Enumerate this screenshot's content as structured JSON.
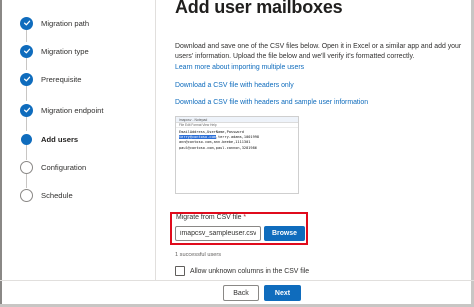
{
  "wizard": {
    "steps": [
      {
        "label": "Migration path",
        "state": "done"
      },
      {
        "label": "Migration type",
        "state": "done"
      },
      {
        "label": "Prerequisite",
        "state": "done"
      },
      {
        "label": "Migration endpoint",
        "state": "done"
      },
      {
        "label": "Add users",
        "state": "current"
      },
      {
        "label": "Configuration",
        "state": "todo"
      },
      {
        "label": "Schedule",
        "state": "todo"
      }
    ]
  },
  "main": {
    "title": "Add user mailboxes",
    "description": "Download and save one of the CSV files below. Open it in Excel or a similar app and add your users' information. Upload the file below and we'll verify it's formatted correctly.",
    "learn_more_link": "Learn more about importing multiple users",
    "download_headers_link": "Download a CSV file with headers only",
    "download_sample_link": "Download a CSV file with headers and sample user information",
    "csv_preview": {
      "window_title": "imapcsv - Notepad",
      "menu": "File  Edit  Format  View  Help",
      "lines": [
        "EmailAddress,UserName,Password",
        "terry@contoso.com,terry.adams,1001998",
        "ann@contoso.com,ann.beebe,1111301",
        "paul@contoso.com,paul.cannon,3281986"
      ],
      "selected_text": "terry@contoso.com"
    },
    "upload": {
      "label": "Migrate from CSV file",
      "required_mark": "*",
      "file_value": "imapcsv_sampleuser.csv",
      "browse_label": "Browse"
    },
    "status_text": "1 successful users",
    "allow_unknown_columns": {
      "label": "Allow unknown columns in the CSV file",
      "checked": false
    }
  },
  "footer": {
    "back_label": "Back",
    "next_label": "Next"
  },
  "colors": {
    "accent": "#0f6cbd",
    "highlight": "#e00b1c"
  }
}
